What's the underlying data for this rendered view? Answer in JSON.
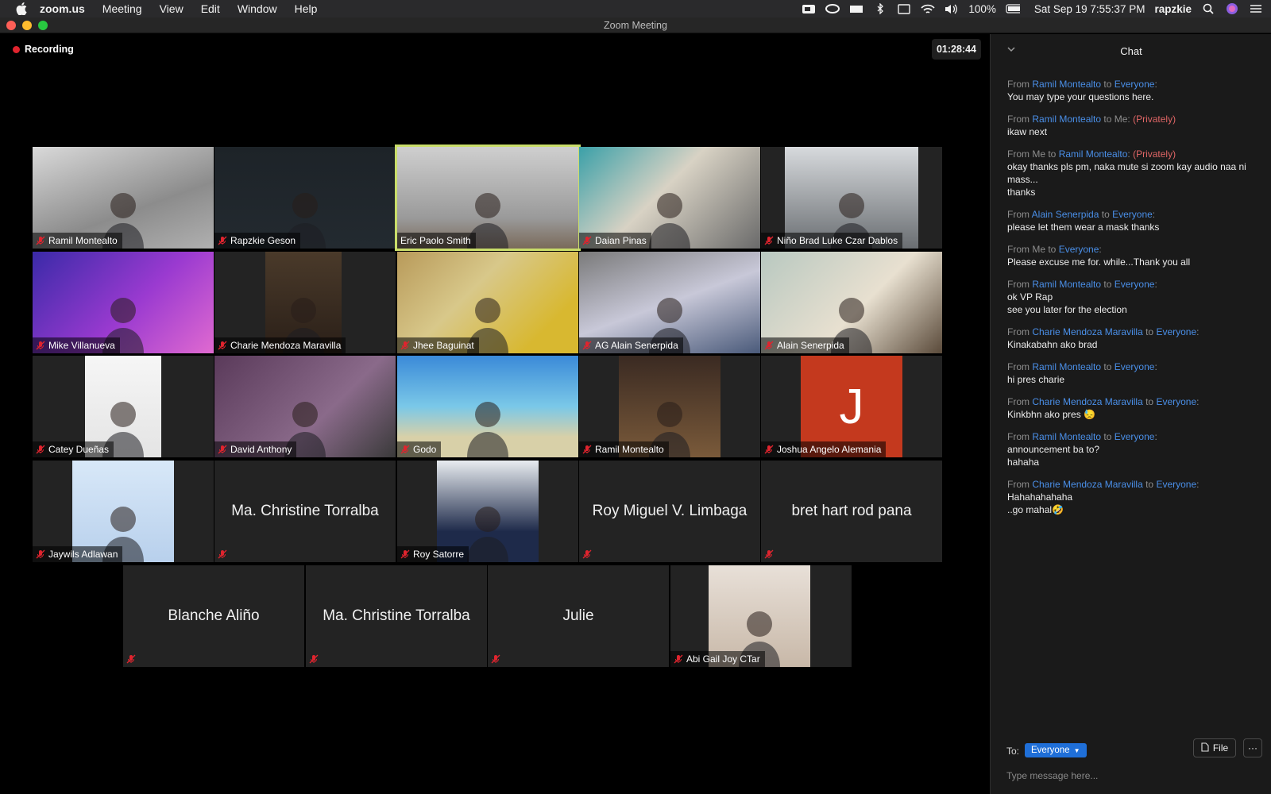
{
  "menubar": {
    "app": "zoom.us",
    "items": [
      "Meeting",
      "View",
      "Edit",
      "Window",
      "Help"
    ],
    "battery": "100%",
    "datetime": "Sat Sep 19  7:55:37 PM",
    "user": "rapzkie"
  },
  "window": {
    "title": "Zoom Meeting"
  },
  "stage": {
    "recording_label": "Recording",
    "timer": "01:28:44"
  },
  "participants": [
    {
      "name": "Ramil Montealto",
      "muted": true,
      "video": true
    },
    {
      "name": "Rapzkie Geson",
      "muted": true,
      "video": true
    },
    {
      "name": "Eric Paolo Smith",
      "muted": false,
      "video": true,
      "active_speaker": true
    },
    {
      "name": "Daian Pinas",
      "muted": true,
      "video": true
    },
    {
      "name": "Niño Brad Luke Czar Dablos",
      "muted": true,
      "video": true
    },
    {
      "name": "Mike Villanueva",
      "muted": true,
      "video": true
    },
    {
      "name": "Charie Mendoza Maravilla",
      "muted": true,
      "video": true
    },
    {
      "name": "Jhee Baguinat",
      "muted": true,
      "video": true
    },
    {
      "name": "AG Alain Senerpida",
      "muted": true,
      "video": true
    },
    {
      "name": "Alain Senerpida",
      "muted": true,
      "video": true
    },
    {
      "name": "Catey Dueñas",
      "muted": true,
      "video": true
    },
    {
      "name": "David Anthony",
      "muted": true,
      "video": true
    },
    {
      "name": "Godo",
      "muted": true,
      "video": true
    },
    {
      "name": "Ramil Montealto",
      "muted": true,
      "video": true
    },
    {
      "name": "Joshua Angelo Alemania",
      "muted": true,
      "video": true,
      "avatar_letter": "J"
    },
    {
      "name": "Jaywils Adlawan",
      "muted": true,
      "video": true
    },
    {
      "name": "Ma. Christine Torralba",
      "muted": true,
      "video": false
    },
    {
      "name": "Roy Satorre",
      "muted": true,
      "video": true
    },
    {
      "name": "Roy Miguel V. Limbaga",
      "muted": true,
      "video": false
    },
    {
      "name": "bret hart rod pana",
      "muted": true,
      "video": false
    },
    {
      "name": "Blanche Aliño",
      "muted": true,
      "video": false
    },
    {
      "name": "Ma. Christine Torralba",
      "muted": true,
      "video": false
    },
    {
      "name": "Julie",
      "muted": true,
      "video": false
    },
    {
      "name": "Abi Gail Joy CTar",
      "muted": true,
      "video": true
    }
  ],
  "chat": {
    "title": "Chat",
    "messages": [
      {
        "from": "Ramil Montealto",
        "to": "Everyone",
        "private": "",
        "text": "You may type your questions here."
      },
      {
        "from": "Ramil Montealto",
        "to": "Me",
        "private": "(Privately)",
        "text": "ikaw next"
      },
      {
        "from": "Me",
        "to": "Ramil Montealto",
        "private": "(Privately)",
        "text": "okay thanks pls pm, naka mute si zoom kay audio naa ni mass...\nthanks"
      },
      {
        "from": "Alain Senerpida",
        "to": "Everyone",
        "private": "",
        "text": "please let them wear a mask thanks"
      },
      {
        "from": "Me",
        "to": "Everyone",
        "private": "",
        "text": "Please excuse me for. while...Thank you all"
      },
      {
        "from": "Ramil Montealto",
        "to": "Everyone",
        "private": "",
        "text": "ok VP Rap\nsee you later for the election"
      },
      {
        "from": "Charie Mendoza Maravilla",
        "to": "Everyone",
        "private": "",
        "text": "Kinakabahn ako brad"
      },
      {
        "from": "Ramil Montealto",
        "to": "Everyone",
        "private": "",
        "text": "hi pres charie"
      },
      {
        "from": "Charie Mendoza Maravilla",
        "to": "Everyone",
        "private": "",
        "text": "Kinkbhn ako pres 😓"
      },
      {
        "from": "Ramil Montealto",
        "to": "Everyone",
        "private": "",
        "text": "announcement ba to?\nhahaha"
      },
      {
        "from": "Charie Mendoza Maravilla",
        "to": "Everyone",
        "private": "",
        "text": "Hahahahahaha\n..go mahal🤣"
      }
    ],
    "to_label": "To:",
    "to_value": "Everyone",
    "file_label": "File",
    "more_label": "···",
    "input_placeholder": "Type message here..."
  }
}
